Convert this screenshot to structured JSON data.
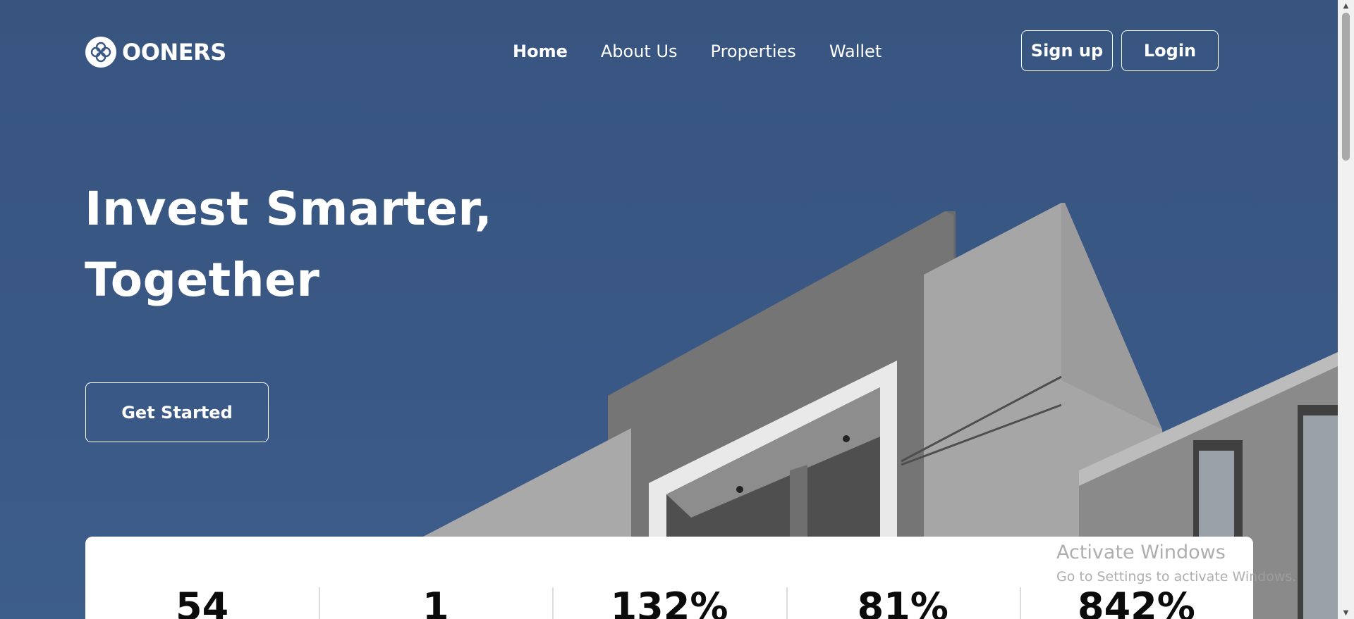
{
  "brand": {
    "name": "OONERS",
    "logo_icon": "quatrefoil-logo-icon"
  },
  "nav": {
    "items": [
      {
        "label": "Home",
        "active": true
      },
      {
        "label": "About Us",
        "active": false
      },
      {
        "label": "Properties",
        "active": false
      },
      {
        "label": "Wallet",
        "active": false
      }
    ]
  },
  "auth": {
    "signup_label": "Sign up",
    "login_label": "Login"
  },
  "hero": {
    "headline_line1": "Invest Smarter,",
    "headline_line2": "Together",
    "cta_label": "Get Started"
  },
  "stats": [
    {
      "value": "54"
    },
    {
      "value": "1"
    },
    {
      "value": "132%"
    },
    {
      "value": "81%"
    },
    {
      "value": "842%"
    }
  ],
  "os_watermark": {
    "title": "Activate Windows",
    "subtitle": "Go to Settings to activate Windows."
  },
  "colors": {
    "sky": "#3a5884",
    "text_light": "#ffffff",
    "card_bg": "#ffffff",
    "stat_text": "#0b0b0b"
  }
}
